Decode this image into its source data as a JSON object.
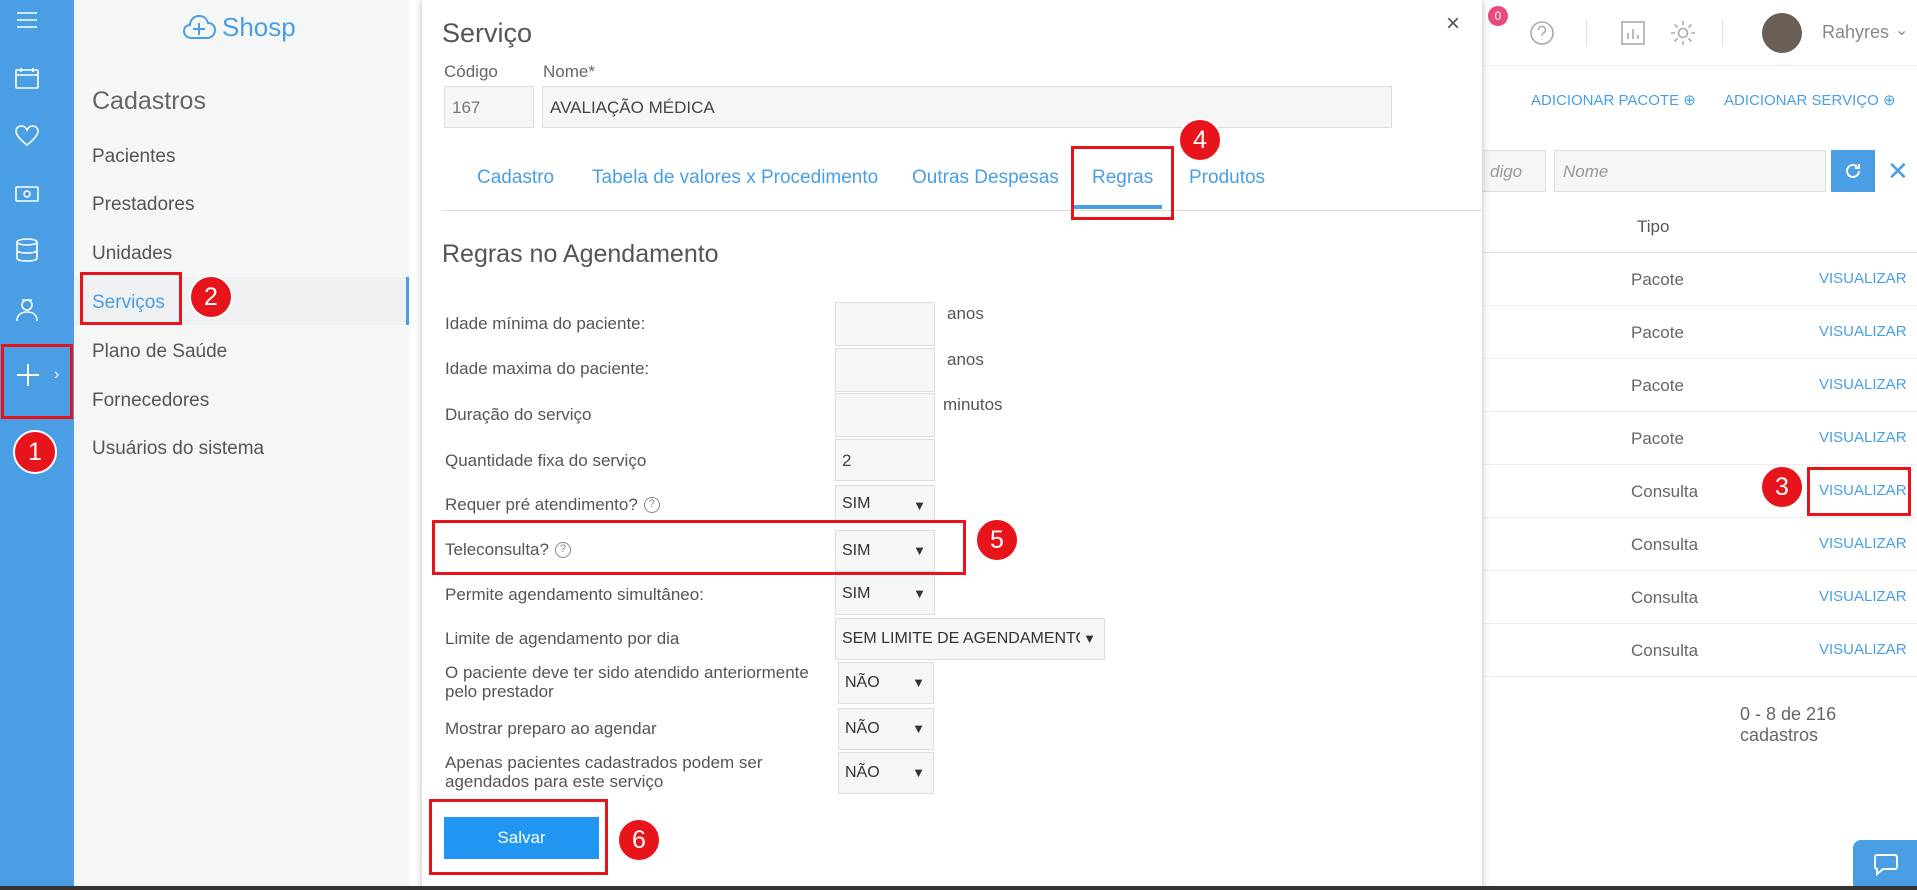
{
  "app": {
    "logo": "Shosp"
  },
  "menu": {
    "heading": "Cadastros",
    "items": [
      "Pacientes",
      "Prestadores",
      "Unidades",
      "Serviços",
      "Plano de Saúde",
      "Fornecedores",
      "Usuários do sistema"
    ],
    "active": "Serviços"
  },
  "topbar": {
    "notification_count": "0",
    "user": "Rahyres"
  },
  "page": {
    "add_package": "ADICIONAR PACOTE",
    "add_service": "ADICIONAR SERVIÇO",
    "filter_code_placeholder": "digo",
    "filter_name_placeholder": "Nome",
    "column_type": "Tipo",
    "rows": [
      {
        "type": "Pacote",
        "action": "VISUALIZAR"
      },
      {
        "type": "Pacote",
        "action": "VISUALIZAR"
      },
      {
        "type": "Pacote",
        "action": "VISUALIZAR"
      },
      {
        "type": "Pacote",
        "action": "VISUALIZAR"
      },
      {
        "type": "Consulta",
        "action": "VISUALIZAR"
      },
      {
        "type": "Consulta",
        "action": "VISUALIZAR"
      },
      {
        "type": "Consulta",
        "action": "VISUALIZAR"
      },
      {
        "type": "Consulta",
        "action": "VISUALIZAR"
      }
    ],
    "count_text": "0 - 8 de 216 cadastros"
  },
  "modal": {
    "title": "Serviço",
    "close": "×",
    "code_label": "Código",
    "code_value": "167",
    "name_label": "Nome*",
    "name_value": "AVALIAÇÃO MÉDICA",
    "tabs": [
      "Cadastro",
      "Tabela de valores x Procedimento",
      "Outras Despesas",
      "Regras",
      "Produtos"
    ],
    "active_tab": "Regras",
    "section_title": "Regras no Agendamento",
    "rules": {
      "min_age_label": "Idade mínima do paciente:",
      "min_age_value": "",
      "min_age_unit": "anos",
      "max_age_label": "Idade maxima do paciente:",
      "max_age_value": "",
      "max_age_unit": "anos",
      "duration_label": "Duração do serviço",
      "duration_value": "",
      "duration_unit": "minutos",
      "fixed_qty_label": "Quantidade fixa do serviço",
      "fixed_qty_value": "2",
      "pre_care_label": "Requer pré atendimento?",
      "pre_care_value": "SIM",
      "teleconsult_label": "Teleconsulta?",
      "teleconsult_value": "SIM",
      "simultaneous_label": "Permite agendamento simultâneo:",
      "simultaneous_value": "SIM",
      "daily_limit_label": "Limite de agendamento por dia",
      "daily_limit_value": "SEM LIMITE DE AGENDAMENTO",
      "prior_care_label": "O paciente deve ter sido atendido anteriormente pelo prestador",
      "prior_care_value": "NÃO",
      "show_prep_label": "Mostrar preparo ao agendar",
      "show_prep_value": "NÃO",
      "registered_only_label": "Apenas pacientes cadastrados podem ser agendados para este serviço",
      "registered_only_value": "NÃO"
    },
    "save_label": "Salvar"
  },
  "annotations": [
    "1",
    "2",
    "3",
    "4",
    "5",
    "6"
  ],
  "colors": {
    "accent": "#4a9ee4",
    "annotation": "#e8141b",
    "save": "#2196f3"
  }
}
